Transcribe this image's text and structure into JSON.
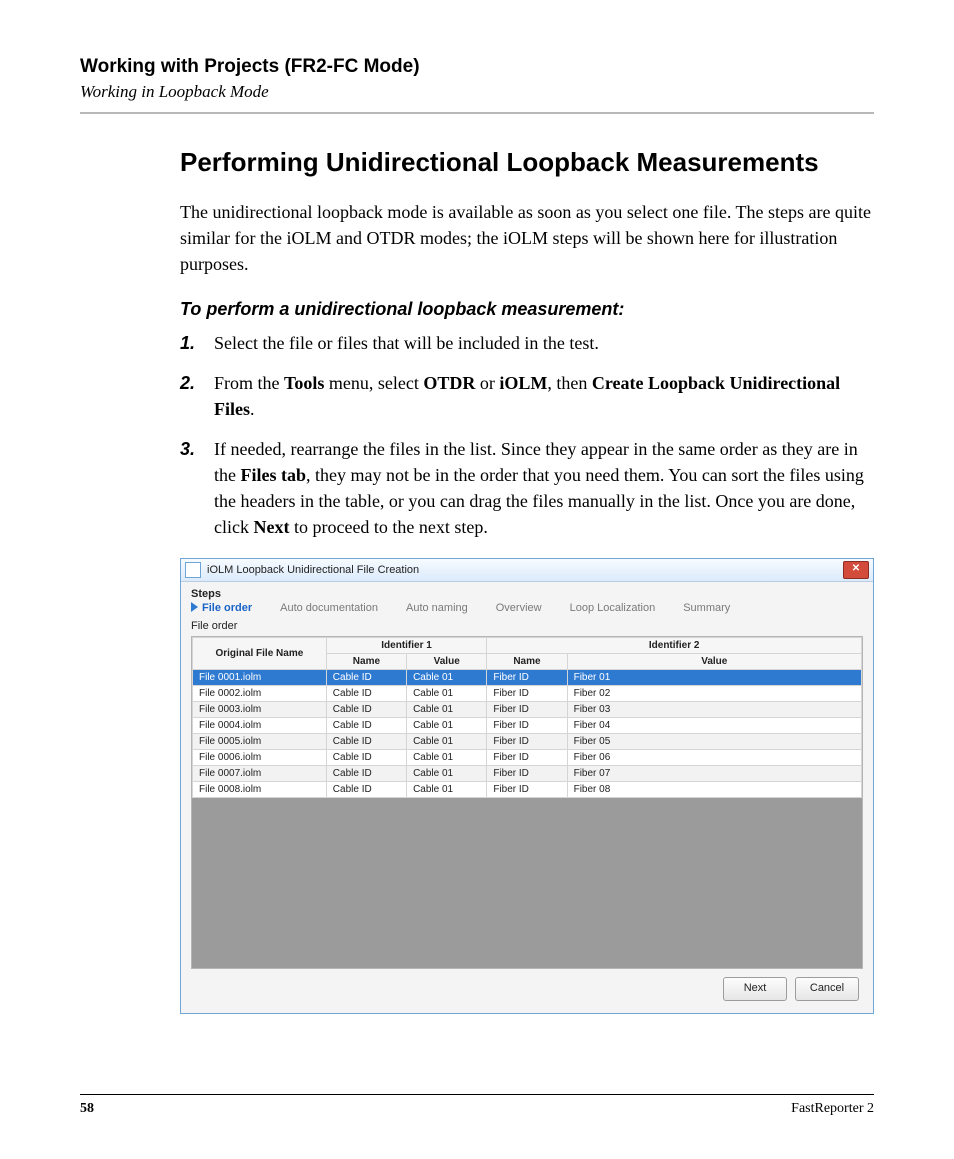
{
  "header": {
    "chapter": "Working with Projects (FR2-FC Mode)",
    "section": "Working in Loopback Mode"
  },
  "title": "Performing Unidirectional Loopback Measurements",
  "intro": "The unidirectional loopback mode is available as soon as you select one file. The steps are quite similar for the iOLM and OTDR modes; the iOLM steps will be shown here for illustration purposes.",
  "subhead": "To perform a unidirectional loopback measurement:",
  "steps": {
    "s1": {
      "num": "1.",
      "text": "Select the file or files that will be included in the test."
    },
    "s2": {
      "num": "2.",
      "a": "From the ",
      "b": "Tools",
      "c": " menu, select ",
      "d": "OTDR",
      "e": " or ",
      "f": "iOLM",
      "g": ", then ",
      "h": "Create Loopback Unidirectional Files",
      "i": "."
    },
    "s3": {
      "num": "3.",
      "a": "If needed, rearrange the files in the list. Since they appear in the same order as they are in the ",
      "b": "Files tab",
      "c": ", they may not be in the order that you need them. You can sort the files using the headers in the table, or you can drag the files manually in the list. Once you are done, click ",
      "d": "Next",
      "e": " to proceed to the next step."
    }
  },
  "dialog": {
    "title": "iOLM Loopback Unidirectional File Creation",
    "close": "✕",
    "stepsLabel": "Steps",
    "wizardSteps": {
      "s0": "File order",
      "s1": "Auto documentation",
      "s2": "Auto naming",
      "s3": "Overview",
      "s4": "Loop Localization",
      "s5": "Summary"
    },
    "fileOrderLabel": "File order",
    "columns": {
      "orig": "Original File Name",
      "id1": "Identifier 1",
      "id2": "Identifier 2",
      "name": "Name",
      "value": "Value"
    },
    "rows": [
      {
        "file": "File 0001.iolm",
        "n1": "Cable ID",
        "v1": "Cable 01",
        "n2": "Fiber ID",
        "v2": "Fiber 01"
      },
      {
        "file": "File 0002.iolm",
        "n1": "Cable ID",
        "v1": "Cable 01",
        "n2": "Fiber ID",
        "v2": "Fiber 02"
      },
      {
        "file": "File 0003.iolm",
        "n1": "Cable ID",
        "v1": "Cable 01",
        "n2": "Fiber ID",
        "v2": "Fiber 03"
      },
      {
        "file": "File 0004.iolm",
        "n1": "Cable ID",
        "v1": "Cable 01",
        "n2": "Fiber ID",
        "v2": "Fiber 04"
      },
      {
        "file": "File 0005.iolm",
        "n1": "Cable ID",
        "v1": "Cable 01",
        "n2": "Fiber ID",
        "v2": "Fiber 05"
      },
      {
        "file": "File 0006.iolm",
        "n1": "Cable ID",
        "v1": "Cable 01",
        "n2": "Fiber ID",
        "v2": "Fiber 06"
      },
      {
        "file": "File 0007.iolm",
        "n1": "Cable ID",
        "v1": "Cable 01",
        "n2": "Fiber ID",
        "v2": "Fiber 07"
      },
      {
        "file": "File 0008.iolm",
        "n1": "Cable ID",
        "v1": "Cable 01",
        "n2": "Fiber ID",
        "v2": "Fiber 08"
      }
    ],
    "buttons": {
      "next": "Next",
      "cancel": "Cancel"
    }
  },
  "footer": {
    "page": "58",
    "product": "FastReporter 2"
  }
}
